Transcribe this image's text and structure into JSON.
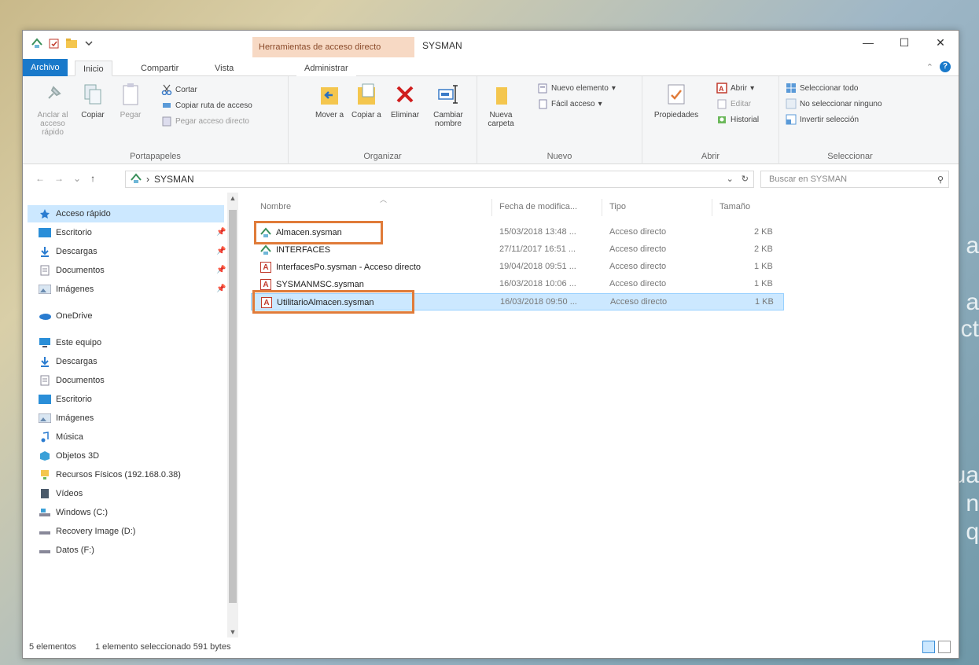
{
  "window": {
    "context_tab_header": "Herramientas de acceso directo",
    "title": "SYSMAN",
    "controls": {
      "minimize": "—",
      "maximize": "☐",
      "close": "✕"
    }
  },
  "tabs": {
    "file": "Archivo",
    "home": "Inicio",
    "share": "Compartir",
    "view": "Vista",
    "manage": "Administrar"
  },
  "ribbon": {
    "clipboard": {
      "label": "Portapapeles",
      "pin": "Anclar al acceso rápido",
      "copy": "Copiar",
      "paste": "Pegar",
      "cut": "Cortar",
      "copy_path": "Copiar ruta de acceso",
      "paste_shortcut": "Pegar acceso directo"
    },
    "organize": {
      "label": "Organizar",
      "move": "Mover a",
      "copy_to": "Copiar a",
      "delete": "Eliminar",
      "rename": "Cambiar nombre"
    },
    "new": {
      "label": "Nuevo",
      "new_folder": "Nueva carpeta",
      "new_item": "Nuevo elemento",
      "easy_access": "Fácil acceso"
    },
    "open": {
      "label": "Abrir",
      "properties": "Propiedades",
      "open": "Abrir",
      "edit": "Editar",
      "history": "Historial"
    },
    "select": {
      "label": "Seleccionar",
      "select_all": "Seleccionar todo",
      "select_none": "No seleccionar ninguno",
      "invert": "Invertir selección"
    }
  },
  "address": {
    "path": "SYSMAN",
    "search_placeholder": "Buscar en SYSMAN"
  },
  "nav": {
    "quick_access": "Acceso rápido",
    "quick_items": [
      "Escritorio",
      "Descargas",
      "Documentos",
      "Imágenes"
    ],
    "onedrive": "OneDrive",
    "this_pc": "Este equipo",
    "pc_items": [
      "Descargas",
      "Documentos",
      "Escritorio",
      "Imágenes",
      "Música",
      "Objetos 3D",
      "Recursos Físicos (192.168.0.38)",
      "Vídeos",
      "Windows (C:)",
      "Recovery Image (D:)",
      "Datos (F:)"
    ]
  },
  "columns": {
    "name": "Nombre",
    "date": "Fecha de modifica...",
    "type": "Tipo",
    "size": "Tamaño"
  },
  "files": [
    {
      "name": "Almacen.sysman",
      "date": "15/03/2018 13:48 ...",
      "type": "Acceso directo",
      "size": "2 KB",
      "icon": "sysman-app-icon"
    },
    {
      "name": "INTERFACES",
      "date": "27/11/2017 16:51 ...",
      "type": "Acceso directo",
      "size": "2 KB",
      "icon": "sysman-app-icon"
    },
    {
      "name": "InterfacesPo.sysman - Acceso directo",
      "date": "19/04/2018 09:51 ...",
      "type": "Acceso directo",
      "size": "1 KB",
      "icon": "red-document-icon"
    },
    {
      "name": "SYSMANMSC.sysman",
      "date": "16/03/2018 10:06 ...",
      "type": "Acceso directo",
      "size": "1 KB",
      "icon": "red-document-icon"
    },
    {
      "name": "UtilitarioAlmacen.sysman",
      "date": "16/03/2018 09:50 ...",
      "type": "Acceso directo",
      "size": "1 KB",
      "icon": "red-document-icon"
    }
  ],
  "status": {
    "count": "5 elementos",
    "selection": "1 elemento seleccionado  591 bytes"
  },
  "wallpaper_text": [
    "a",
    "a",
    "ct",
    "ua",
    "n",
    "q"
  ],
  "colors": {
    "accent": "#1979ca",
    "highlight_box": "#e07b39",
    "selection": "#cce8ff"
  }
}
